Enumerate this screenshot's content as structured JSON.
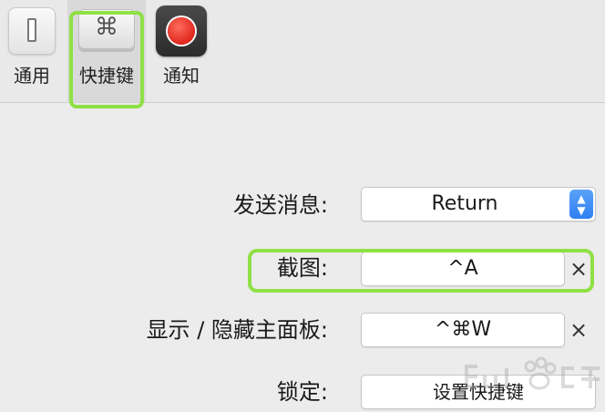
{
  "toolbar": {
    "tabs": [
      {
        "label": "通用",
        "icon": "switch-icon"
      },
      {
        "label": "快捷键",
        "icon": "command-key-icon",
        "key_glyph": "⌘",
        "selected": true
      },
      {
        "label": "通知",
        "icon": "record-dot-icon"
      }
    ]
  },
  "form": {
    "send_message": {
      "label": "发送消息:",
      "value": "Return"
    },
    "screenshot": {
      "label": "截图:",
      "shortcut": "^A",
      "clear_glyph": "×"
    },
    "toggle_panel": {
      "label": "显示 / 隐藏主面板:",
      "shortcut": "^⌘W",
      "clear_glyph": "×"
    },
    "lock": {
      "label": "锁定:",
      "button": "设置快捷键"
    }
  },
  "annotations": {
    "highlight_color": "#8fe045"
  },
  "colors": {
    "stepper_blue": "#2f7ff1",
    "record_red": "#e0281c"
  }
}
